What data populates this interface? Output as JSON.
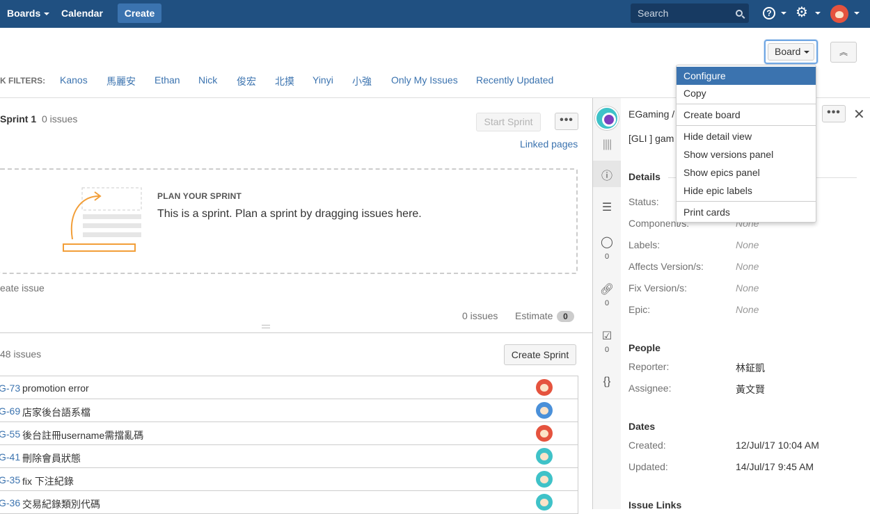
{
  "nav": {
    "boards": "Boards",
    "calendar": "Calendar",
    "create": "Create",
    "search_placeholder": "Search",
    "help": "?",
    "gear": "⚙"
  },
  "board_button": "Board",
  "collapse_icon": "︽",
  "quick_filters": {
    "label": "K FILTERS:",
    "items": [
      "Kanos",
      "馬麗安",
      "Ethan",
      "Nick",
      "俊宏",
      "北摸",
      "Yinyi",
      "小強",
      "Only My Issues",
      "Recently Updated"
    ]
  },
  "sprint": {
    "title": "Sprint 1",
    "count": "0 issues",
    "start_button": "Start Sprint",
    "more": "•••",
    "linked_pages": "Linked pages",
    "plan_title": "PLAN YOUR SPRINT",
    "plan_text": "This is a sprint. Plan a sprint by dragging issues here.",
    "create_issue": "eate issue",
    "footer_count": "0 issues",
    "estimate_label": "Estimate",
    "estimate_value": "0"
  },
  "backlog": {
    "count": "48 issues",
    "create_sprint": "Create Sprint",
    "issues": [
      {
        "key": "G-73",
        "summary": "promotion error",
        "avatar_color": "#e5533e"
      },
      {
        "key": "G-69",
        "summary": "店家後台語系檔",
        "avatar_color": "#4a90d9"
      },
      {
        "key": "G-55",
        "summary": "後台註冊username需擋亂碼",
        "avatar_color": "#e5533e"
      },
      {
        "key": "G-41",
        "summary": "刪除會員狀態",
        "avatar_color": "#3fc2c8"
      },
      {
        "key": "G-35",
        "summary": "fix 下注紀錄",
        "avatar_color": "#3fc2c8"
      },
      {
        "key": "G-36",
        "summary": "交易紀錄類別代碼",
        "avatar_color": "#3fc2c8"
      }
    ]
  },
  "detail": {
    "crumb": "EGaming /",
    "summary": "[GLI ] gam",
    "more": "•••",
    "close": "✕",
    "tabs": {
      "comments_count": "0",
      "attachments_count": "0",
      "subtasks_count": "0"
    },
    "details_head": "Details",
    "fields": [
      {
        "label": "Status:",
        "value": ""
      },
      {
        "label": "Component/s:",
        "value": "None"
      },
      {
        "label": "Labels:",
        "value": "None"
      },
      {
        "label": "Affects Version/s:",
        "value": "None"
      },
      {
        "label": "Fix Version/s:",
        "value": "None"
      },
      {
        "label": "Epic:",
        "value": "None"
      }
    ],
    "people_head": "People",
    "reporter_label": "Reporter:",
    "reporter": "林鉦凱",
    "assignee_label": "Assignee:",
    "assignee": "黃文賢",
    "dates_head": "Dates",
    "created_label": "Created:",
    "created": "12/Jul/17 10:04 AM",
    "updated_label": "Updated:",
    "updated": "14/Jul/17 9:45 AM",
    "links_head": "Issue Links"
  },
  "menu": {
    "items": [
      "Configure",
      "Copy",
      "Create board",
      "Hide detail view",
      "Show versions panel",
      "Show epics panel",
      "Hide epic labels",
      "Print cards"
    ],
    "active": "Configure"
  },
  "colors": {
    "nav_bg": "#205081",
    "link": "#3b73af",
    "menu_active": "#3b73af"
  }
}
